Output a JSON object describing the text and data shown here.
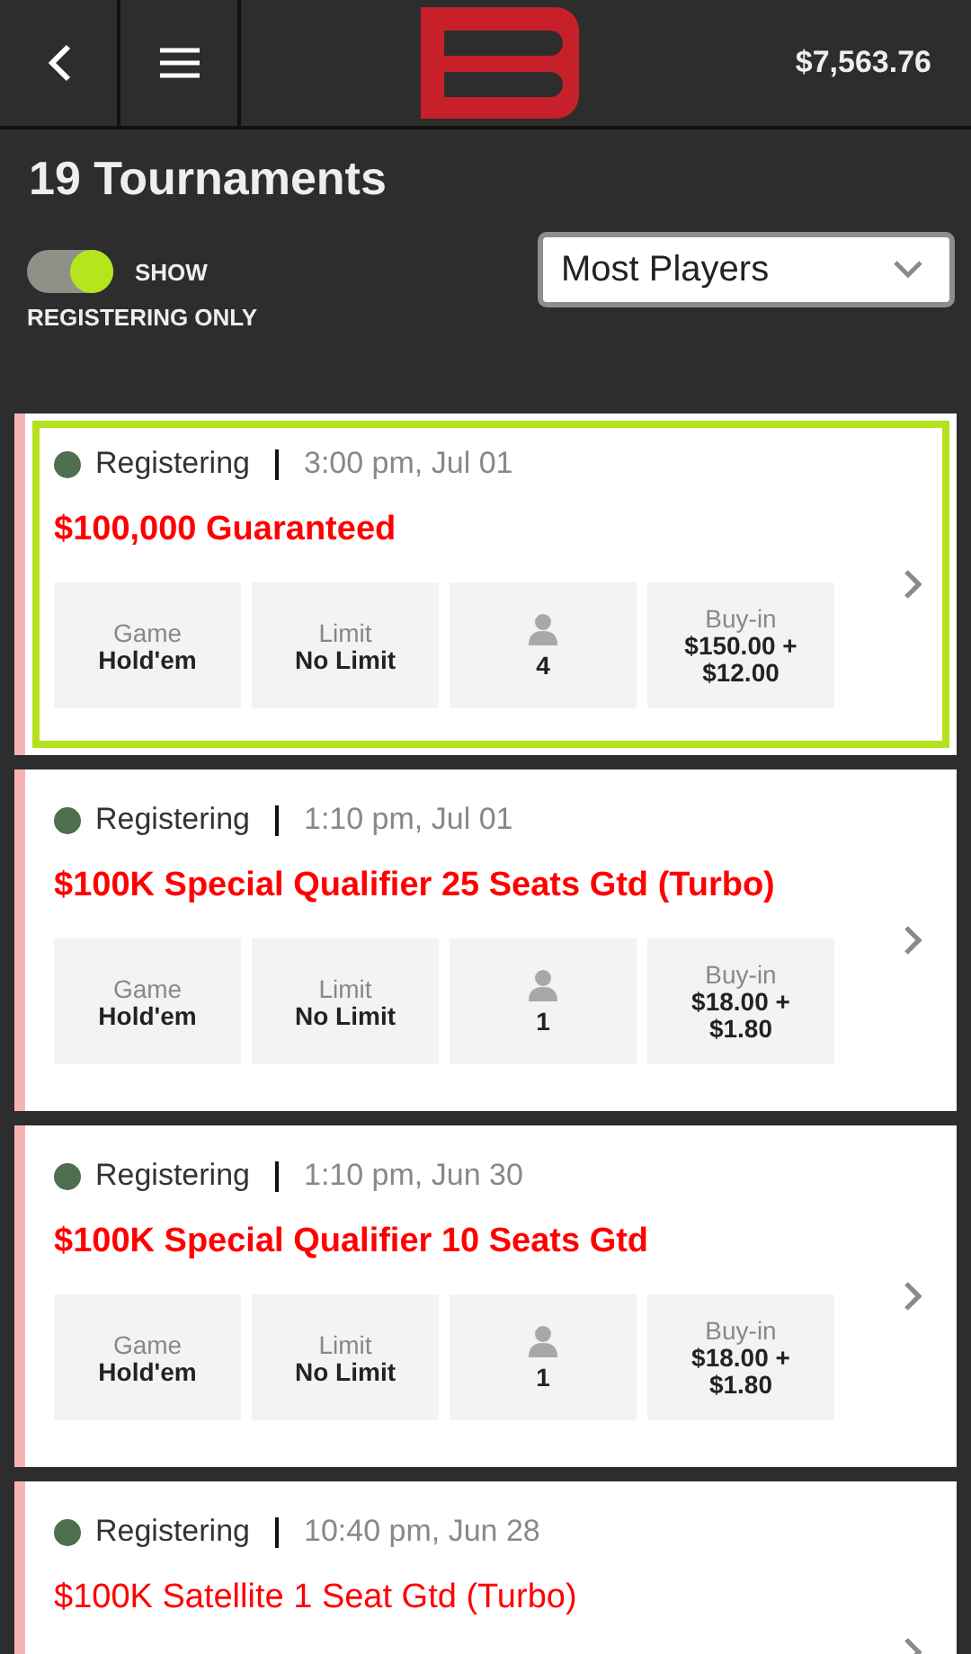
{
  "header": {
    "balance": "$7,563.76"
  },
  "title": "19 Tournaments",
  "filter": {
    "on": true,
    "label_1": "SHOW",
    "label_2": "REGISTERING ONLY"
  },
  "sort": {
    "value": "Most Players"
  },
  "tournaments": [
    {
      "status": "Registering",
      "time": "3:00 pm, Jul 01",
      "name": "$100,000 Guaranteed",
      "bold": true,
      "selected": true,
      "stats": [
        {
          "kind": "label",
          "label": "Game",
          "value": "Hold'em"
        },
        {
          "kind": "label",
          "label": "Limit",
          "value": "No Limit"
        },
        {
          "kind": "players",
          "value": "4"
        },
        {
          "kind": "label",
          "label": "Buy-in",
          "value": "$150.00 + $12.00"
        }
      ]
    },
    {
      "status": "Registering",
      "time": "1:10 pm, Jul 01",
      "name": "$100K Special Qualifier 25 Seats Gtd (Turbo)",
      "bold": true,
      "selected": false,
      "stats": [
        {
          "kind": "label",
          "label": "Game",
          "value": "Hold'em"
        },
        {
          "kind": "label",
          "label": "Limit",
          "value": "No Limit"
        },
        {
          "kind": "players",
          "value": "1"
        },
        {
          "kind": "label",
          "label": "Buy-in",
          "value": "$18.00 + $1.80"
        }
      ]
    },
    {
      "status": "Registering",
      "time": "1:10 pm, Jun 30",
      "name": "$100K Special Qualifier 10 Seats Gtd",
      "bold": true,
      "selected": false,
      "stats": [
        {
          "kind": "label",
          "label": "Game",
          "value": "Hold'em"
        },
        {
          "kind": "label",
          "label": "Limit",
          "value": "No Limit"
        },
        {
          "kind": "players",
          "value": "1"
        },
        {
          "kind": "label",
          "label": "Buy-in",
          "value": "$18.00 + $1.80"
        }
      ]
    },
    {
      "status": "Registering",
      "time": "10:40 pm, Jun 28",
      "name": "$100K Satellite 1 Seat Gtd (Turbo)",
      "bold": false,
      "selected": false
    }
  ]
}
